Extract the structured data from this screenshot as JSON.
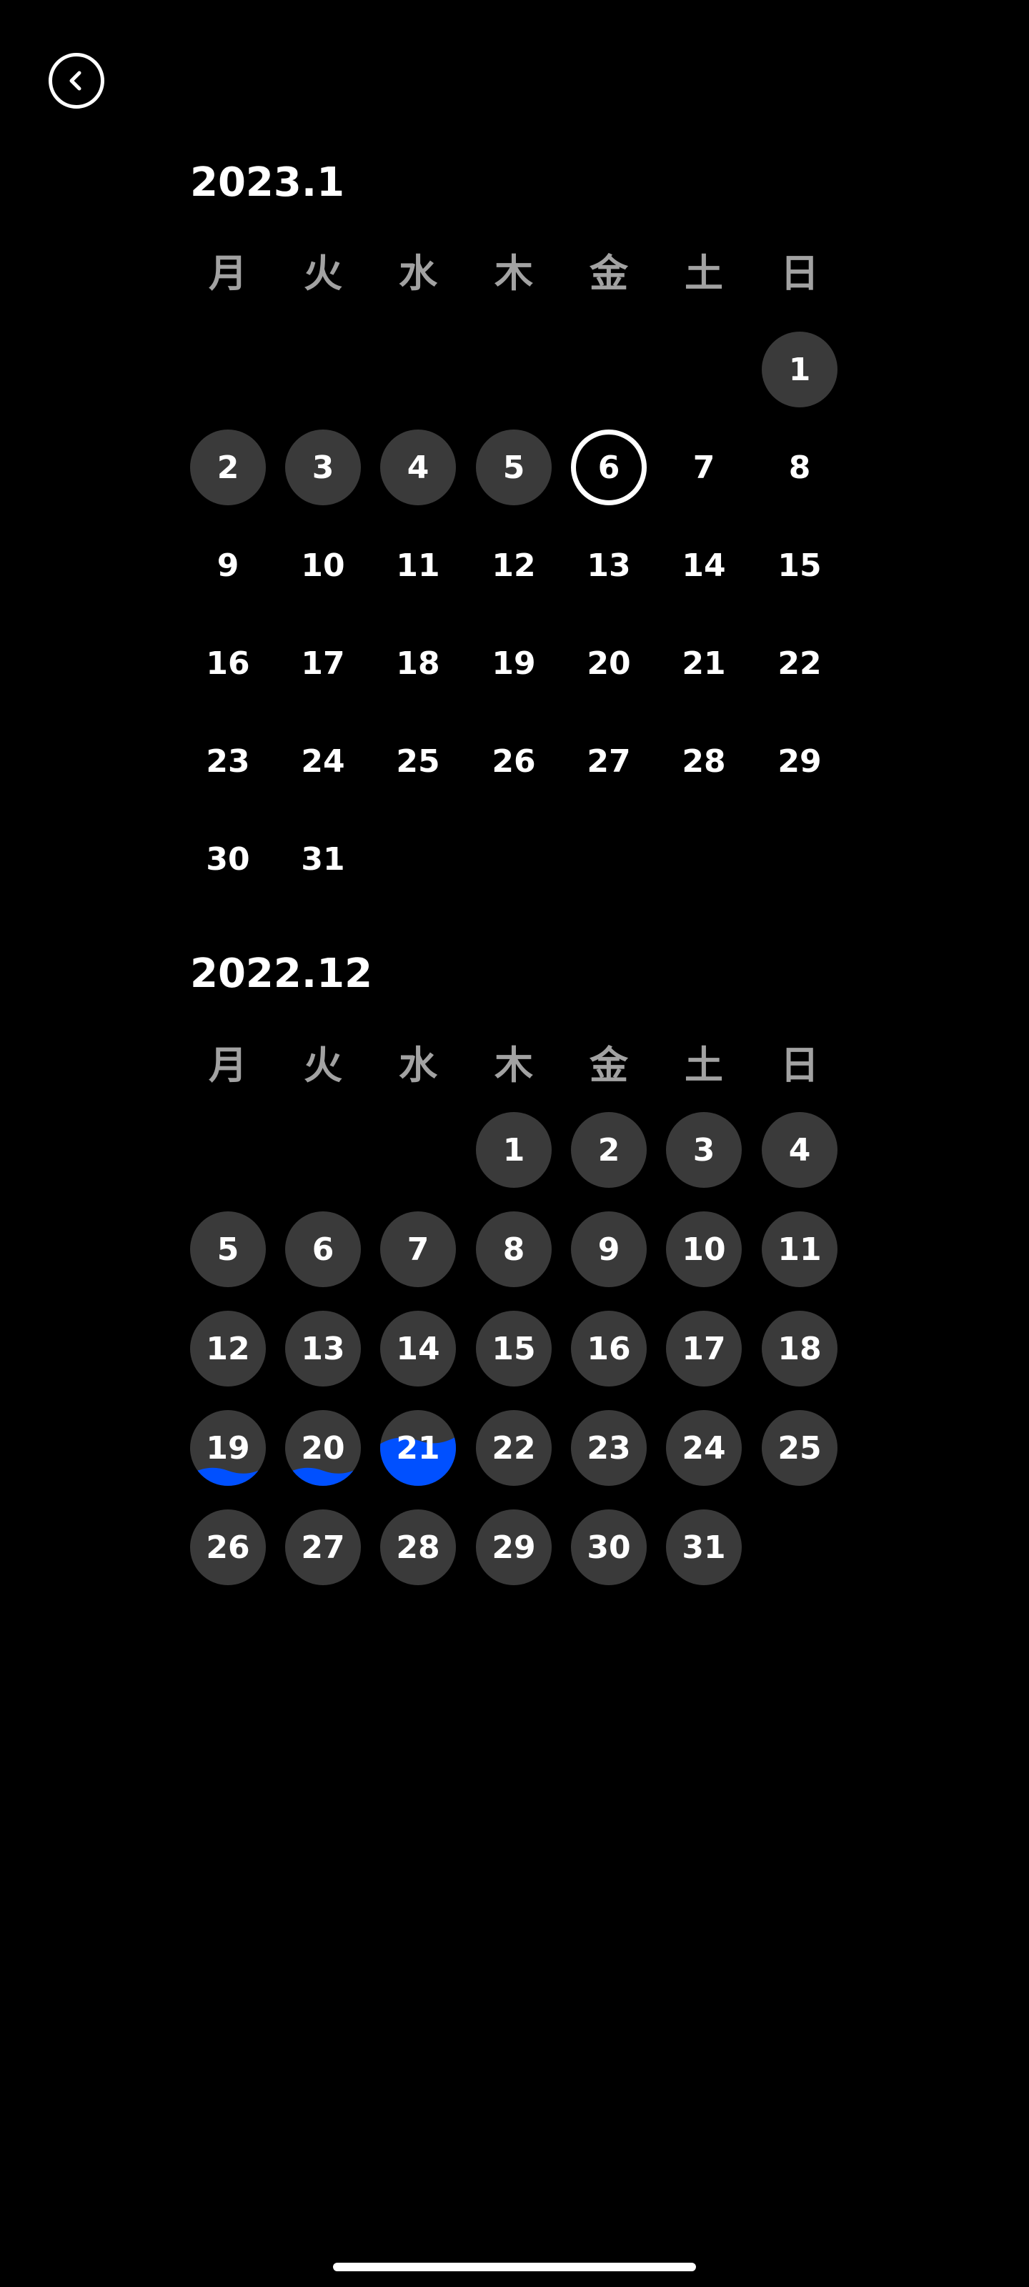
{
  "back_button": {
    "icon": "chevron-left-icon"
  },
  "colors": {
    "background": "#000000",
    "day_circle": "#3a3a3a",
    "weekday_text": "#a2a2a2",
    "progress_fill": "#0050ff"
  },
  "months": [
    {
      "title": "2023.1",
      "weekdays": [
        "月",
        "火",
        "水",
        "木",
        "金",
        "土",
        "日"
      ],
      "first_weekday_index": 6,
      "days": [
        {
          "label": "1",
          "state": "filled"
        },
        {
          "label": "2",
          "state": "filled"
        },
        {
          "label": "3",
          "state": "filled"
        },
        {
          "label": "4",
          "state": "filled"
        },
        {
          "label": "5",
          "state": "filled"
        },
        {
          "label": "6",
          "state": "today"
        },
        {
          "label": "7",
          "state": "empty"
        },
        {
          "label": "8",
          "state": "empty"
        },
        {
          "label": "9",
          "state": "empty"
        },
        {
          "label": "10",
          "state": "empty"
        },
        {
          "label": "11",
          "state": "empty"
        },
        {
          "label": "12",
          "state": "empty"
        },
        {
          "label": "13",
          "state": "empty"
        },
        {
          "label": "14",
          "state": "empty"
        },
        {
          "label": "15",
          "state": "empty"
        },
        {
          "label": "16",
          "state": "empty"
        },
        {
          "label": "17",
          "state": "empty"
        },
        {
          "label": "18",
          "state": "empty"
        },
        {
          "label": "19",
          "state": "empty"
        },
        {
          "label": "20",
          "state": "empty"
        },
        {
          "label": "21",
          "state": "empty"
        },
        {
          "label": "22",
          "state": "empty"
        },
        {
          "label": "23",
          "state": "empty"
        },
        {
          "label": "24",
          "state": "empty"
        },
        {
          "label": "25",
          "state": "empty"
        },
        {
          "label": "26",
          "state": "empty"
        },
        {
          "label": "27",
          "state": "empty"
        },
        {
          "label": "28",
          "state": "empty"
        },
        {
          "label": "29",
          "state": "empty"
        },
        {
          "label": "30",
          "state": "empty"
        },
        {
          "label": "31",
          "state": "empty"
        }
      ]
    },
    {
      "title": "2022.12",
      "weekdays": [
        "月",
        "火",
        "水",
        "木",
        "金",
        "土",
        "日"
      ],
      "first_weekday_index": 3,
      "days": [
        {
          "label": "1",
          "state": "filled"
        },
        {
          "label": "2",
          "state": "filled"
        },
        {
          "label": "3",
          "state": "filled"
        },
        {
          "label": "4",
          "state": "filled"
        },
        {
          "label": "5",
          "state": "filled"
        },
        {
          "label": "6",
          "state": "filled"
        },
        {
          "label": "7",
          "state": "filled"
        },
        {
          "label": "8",
          "state": "filled"
        },
        {
          "label": "9",
          "state": "filled"
        },
        {
          "label": "10",
          "state": "filled"
        },
        {
          "label": "11",
          "state": "filled"
        },
        {
          "label": "12",
          "state": "filled"
        },
        {
          "label": "13",
          "state": "filled"
        },
        {
          "label": "14",
          "state": "filled"
        },
        {
          "label": "15",
          "state": "filled"
        },
        {
          "label": "16",
          "state": "filled"
        },
        {
          "label": "17",
          "state": "filled"
        },
        {
          "label": "18",
          "state": "filled"
        },
        {
          "label": "19",
          "state": "filled",
          "progress": 0.2
        },
        {
          "label": "20",
          "state": "filled",
          "progress": 0.2
        },
        {
          "label": "21",
          "state": "filled",
          "progress": 0.6
        },
        {
          "label": "22",
          "state": "filled"
        },
        {
          "label": "23",
          "state": "filled"
        },
        {
          "label": "24",
          "state": "filled"
        },
        {
          "label": "25",
          "state": "filled"
        },
        {
          "label": "26",
          "state": "filled"
        },
        {
          "label": "27",
          "state": "filled"
        },
        {
          "label": "28",
          "state": "filled"
        },
        {
          "label": "29",
          "state": "filled"
        },
        {
          "label": "30",
          "state": "filled"
        },
        {
          "label": "31",
          "state": "filled"
        }
      ]
    }
  ]
}
